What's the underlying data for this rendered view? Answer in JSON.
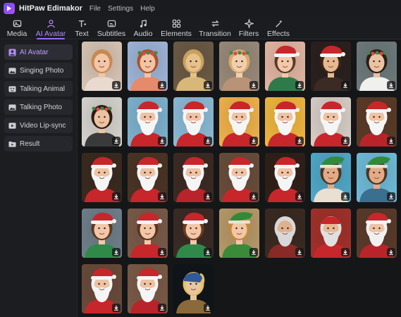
{
  "app": {
    "name": "HitPaw Edimakor"
  },
  "menu": [
    "File",
    "Settings",
    "Help"
  ],
  "toolbar": {
    "tabs": [
      {
        "label": "Media",
        "icon": "media-icon"
      },
      {
        "label": "AI Avatar",
        "icon": "ai-avatar-icon",
        "active": true
      },
      {
        "label": "Text",
        "icon": "text-icon"
      },
      {
        "label": "Subtitles",
        "icon": "subtitles-icon"
      },
      {
        "label": "Audio",
        "icon": "audio-icon"
      },
      {
        "label": "Elements",
        "icon": "elements-icon"
      },
      {
        "label": "Transition",
        "icon": "transition-icon"
      },
      {
        "label": "Filters",
        "icon": "filters-icon"
      },
      {
        "label": "Effects",
        "icon": "effects-icon"
      }
    ]
  },
  "sidebar": {
    "items": [
      {
        "label": "AI Avatar",
        "icon": "avatar-icon",
        "active": true
      },
      {
        "label": "Singing Photo",
        "icon": "photo-icon"
      },
      {
        "label": "Talking Animal",
        "icon": "animal-icon"
      },
      {
        "label": "Talking Photo",
        "icon": "photo-icon"
      },
      {
        "label": "Video Lip-sync",
        "icon": "video-icon"
      },
      {
        "label": "Result",
        "icon": "folder-icon"
      }
    ]
  },
  "colors": {
    "accent": "#9d6bff",
    "accent_text": "#b58bff"
  },
  "avatars": [
    {
      "subject": "baby-cupid",
      "bg": "#d9c6b5",
      "skin": "#f2c6a6",
      "hair": "#c78a52",
      "top": "#e9d9cf",
      "hat": "none"
    },
    {
      "subject": "cartoon-girl-flower-crown",
      "bg": "#9fb6d9",
      "skin": "#f3c3a3",
      "hair": "#a8542c",
      "top": "#e58a6a",
      "hat": "crown"
    },
    {
      "subject": "angel-figurine",
      "bg": "#6b5a45",
      "skin": "#e5c28c",
      "hair": "#c9a05b",
      "top": "#d9b779",
      "hat": "none"
    },
    {
      "subject": "girl-flower-crown",
      "bg": "#9a8a7a",
      "skin": "#f0cfae",
      "hair": "#d9a86a",
      "top": "#b89378",
      "hat": "crown"
    },
    {
      "subject": "girl-santa-hat",
      "bg": "#e4b6a3",
      "skin": "#f1c9aa",
      "hair": "#5a3a26",
      "top": "#2f7a4a",
      "hat": "santa"
    },
    {
      "subject": "woman-santa-hat",
      "bg": "#2a201d",
      "skin": "#e7b991",
      "hair": "#3a2418",
      "top": "#3b2b24",
      "hat": "santa"
    },
    {
      "subject": "woman-wreath",
      "bg": "#6e7a7c",
      "skin": "#eac3a3",
      "hair": "#2a1d17",
      "top": "#f0f0ee",
      "hat": "crown"
    },
    {
      "subject": "woman-wreath-2",
      "bg": "#d8d5cf",
      "skin": "#ecc3a2",
      "hair": "#2b1b14",
      "top": "#3a3a3a",
      "hat": "crown"
    },
    {
      "subject": "santa-claus",
      "bg": "#7eb3cf",
      "skin": "#eec2a3",
      "hair": "#f5f5f5",
      "top": "#c7262b",
      "hat": "santa"
    },
    {
      "subject": "santa-claus",
      "bg": "#8bbbd7",
      "skin": "#eec2a3",
      "hair": "#f5f5f5",
      "top": "#c7262b",
      "hat": "santa"
    },
    {
      "subject": "santa-claus-thumbs-up",
      "bg": "#f0b34a",
      "skin": "#eec2a3",
      "hair": "#f5f5f5",
      "top": "#c7262b",
      "hat": "santa"
    },
    {
      "subject": "santa-claus",
      "bg": "#f1b73e",
      "skin": "#eec2a3",
      "hair": "#f5f5f5",
      "top": "#c7262b",
      "hat": "santa"
    },
    {
      "subject": "santa-claus-hands",
      "bg": "#d9cfc8",
      "skin": "#eec2a3",
      "hair": "#f5f5f5",
      "top": "#c7262b",
      "hat": "santa"
    },
    {
      "subject": "santa-claus-room",
      "bg": "#5a3a26",
      "skin": "#eec2a3",
      "hair": "#f5f5f5",
      "top": "#b8242a",
      "hat": "santa"
    },
    {
      "subject": "santa-claus-bokeh",
      "bg": "#3a2a1f",
      "skin": "#eec2a3",
      "hair": "#f5f5f5",
      "top": "#c7262b",
      "hat": "santa"
    },
    {
      "subject": "santa-claus-tree",
      "bg": "#4a3324",
      "skin": "#eec2a3",
      "hair": "#f5f5f5",
      "top": "#c7262b",
      "hat": "santa"
    },
    {
      "subject": "santa-claus-full",
      "bg": "#3b2a22",
      "skin": "#eec2a3",
      "hair": "#f5f5f5",
      "top": "#b8242a",
      "hat": "santa"
    },
    {
      "subject": "santa-claus-closeup",
      "bg": "#6a4c3a",
      "skin": "#eec2a3",
      "hair": "#f5f5f5",
      "top": "#c7262b",
      "hat": "santa"
    },
    {
      "subject": "santa-claus-smile",
      "bg": "#2f1f18",
      "skin": "#eec2a3",
      "hair": "#f5f5f5",
      "top": "#c7262b",
      "hat": "santa"
    },
    {
      "subject": "man-green-elf-hat",
      "bg": "#4fa9c9",
      "skin": "#e2ab86",
      "hair": "#4a3526",
      "top": "#e9e0d2",
      "hat": "elf"
    },
    {
      "subject": "man-green-elf-hat",
      "bg": "#6fbcd9",
      "skin": "#e2ab86",
      "hair": "#4a3526",
      "top": "#3b6f8f",
      "hat": "elf"
    },
    {
      "subject": "cartoon-elf-boy",
      "bg": "#6f7f8a",
      "skin": "#f2c7a8",
      "hair": "#5a3a22",
      "top": "#2f8a4a",
      "hat": "santa"
    },
    {
      "subject": "cartoon-elf-girl",
      "bg": "#7a5a48",
      "skin": "#f2c7a8",
      "hair": "#5a3420",
      "top": "#c7262b",
      "hat": "santa"
    },
    {
      "subject": "cartoon-elf-girl-red-hat",
      "bg": "#3a2a24",
      "skin": "#f2c7a8",
      "hair": "#6a3a22",
      "top": "#2f8a4a",
      "hat": "santa"
    },
    {
      "subject": "cartoon-elf-green-hat",
      "bg": "#b89a6a",
      "skin": "#f2c7a8",
      "hair": "#c48a3a",
      "top": "#3b8a3a",
      "hat": "elf"
    },
    {
      "subject": "old-man-tree",
      "bg": "#3a2a20",
      "skin": "#e0b18e",
      "hair": "#d8d8d8",
      "top": "#8a2a26",
      "hat": "none"
    },
    {
      "subject": "old-man-red-hat-glasses",
      "bg": "#a3302a",
      "skin": "#e8b894",
      "hair": "#e0e0e0",
      "top": "#c7262b",
      "hat": "beanie"
    },
    {
      "subject": "santa-fireplace",
      "bg": "#5a3a2a",
      "skin": "#eec2a3",
      "hair": "#f0f0f0",
      "top": "#b8242a",
      "hat": "santa"
    },
    {
      "subject": "santa-claus-sitting",
      "bg": "#6a4a3a",
      "skin": "#eec2a3",
      "hair": "#f5f5f5",
      "top": "#c7262b",
      "hat": "santa"
    },
    {
      "subject": "santa-claus-chair",
      "bg": "#7a5a46",
      "skin": "#eec2a3",
      "hair": "#f5f5f5",
      "top": "#b8242a",
      "hat": "santa"
    },
    {
      "subject": "girl-pearl-earring",
      "bg": "#0f1418",
      "skin": "#e8c7a0",
      "hair": "#e8c060",
      "top": "#8a6a3a",
      "hat": "turban"
    }
  ]
}
